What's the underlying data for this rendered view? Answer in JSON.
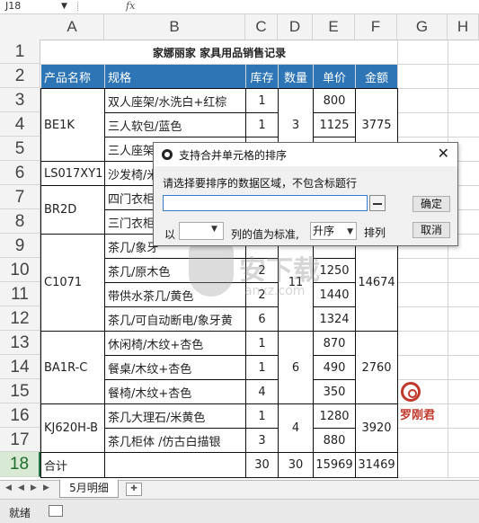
{
  "formula_bar": {
    "cell_ref": "J18",
    "fx": "fx"
  },
  "columns": [
    "A",
    "B",
    "C",
    "D",
    "E",
    "F",
    "G",
    "H"
  ],
  "rows": [
    "1",
    "2",
    "3",
    "4",
    "5",
    "6",
    "7",
    "8",
    "9",
    "10",
    "11",
    "12",
    "13",
    "14",
    "15",
    "16",
    "17",
    "18"
  ],
  "selected_row": "18",
  "sheet": {
    "title": "家娜丽家 家具用品销售记录",
    "headers": [
      "产品名称",
      "规格",
      "库存",
      "数量",
      "单价",
      "金额"
    ],
    "row3": {
      "A": "BE1K",
      "B": "双人座架/水洗白+红棕",
      "C": "1",
      "E": "800"
    },
    "row4": {
      "B": "三人软包/蓝色",
      "C": "1",
      "D": "3",
      "E": "1125",
      "F": "3775"
    },
    "row5": {
      "B": "三人座架"
    },
    "row6": {
      "A": "LS017XY1",
      "B": "沙发椅/米"
    },
    "row7": {
      "A": "BR2D",
      "B": "四门衣柜"
    },
    "row8": {
      "B": "三门衣柜"
    },
    "row9": {
      "B": "茶几/象牙"
    },
    "row10": {
      "A": "C1071",
      "B": "茶几/原木色",
      "C": "2",
      "D": "11",
      "E": "1250",
      "F": "14674"
    },
    "row11": {
      "B": "带供水茶几/黄色",
      "C": "2",
      "E": "1440"
    },
    "row12": {
      "B": "茶几/可自动断电/象牙黄",
      "C": "6",
      "E": "1324"
    },
    "row13": {
      "A": "BA1R-C",
      "B": "休闲椅/木纹+杏色",
      "C": "1",
      "E": "870"
    },
    "row14": {
      "B": "餐桌/木纹+杏色",
      "C": "1",
      "D": "6",
      "E": "490",
      "F": "2760"
    },
    "row15": {
      "B": "餐椅/木纹+杏色",
      "C": "4",
      "E": "350"
    },
    "row16": {
      "A": "KJ620H-B",
      "B": "茶几大理石/米黄色",
      "C": "1",
      "E": "1280"
    },
    "row17": {
      "B": "茶几柜体 /仿古白描银",
      "C": "3",
      "D": "4",
      "E": "880",
      "F": "3920"
    },
    "row18": {
      "A": "合计",
      "C": "30",
      "D": "30",
      "E": "15969",
      "F": "31469"
    }
  },
  "sheet_tab": "5月明细",
  "status": "就绪",
  "dialog": {
    "title": "支持合并单元格的排序",
    "prompt": "请选择要排序的数据区域，不包含标题行",
    "range_value": "",
    "ok": "确定",
    "cancel": "取消",
    "by": "以",
    "column_label": "列的值为标准,",
    "order_value": "升序",
    "sort_label": "排列"
  },
  "watermark": {
    "main": "安下载",
    "sub": "anxz.com"
  },
  "stamp_text": "罗刚君",
  "accent": "#2e75b6"
}
